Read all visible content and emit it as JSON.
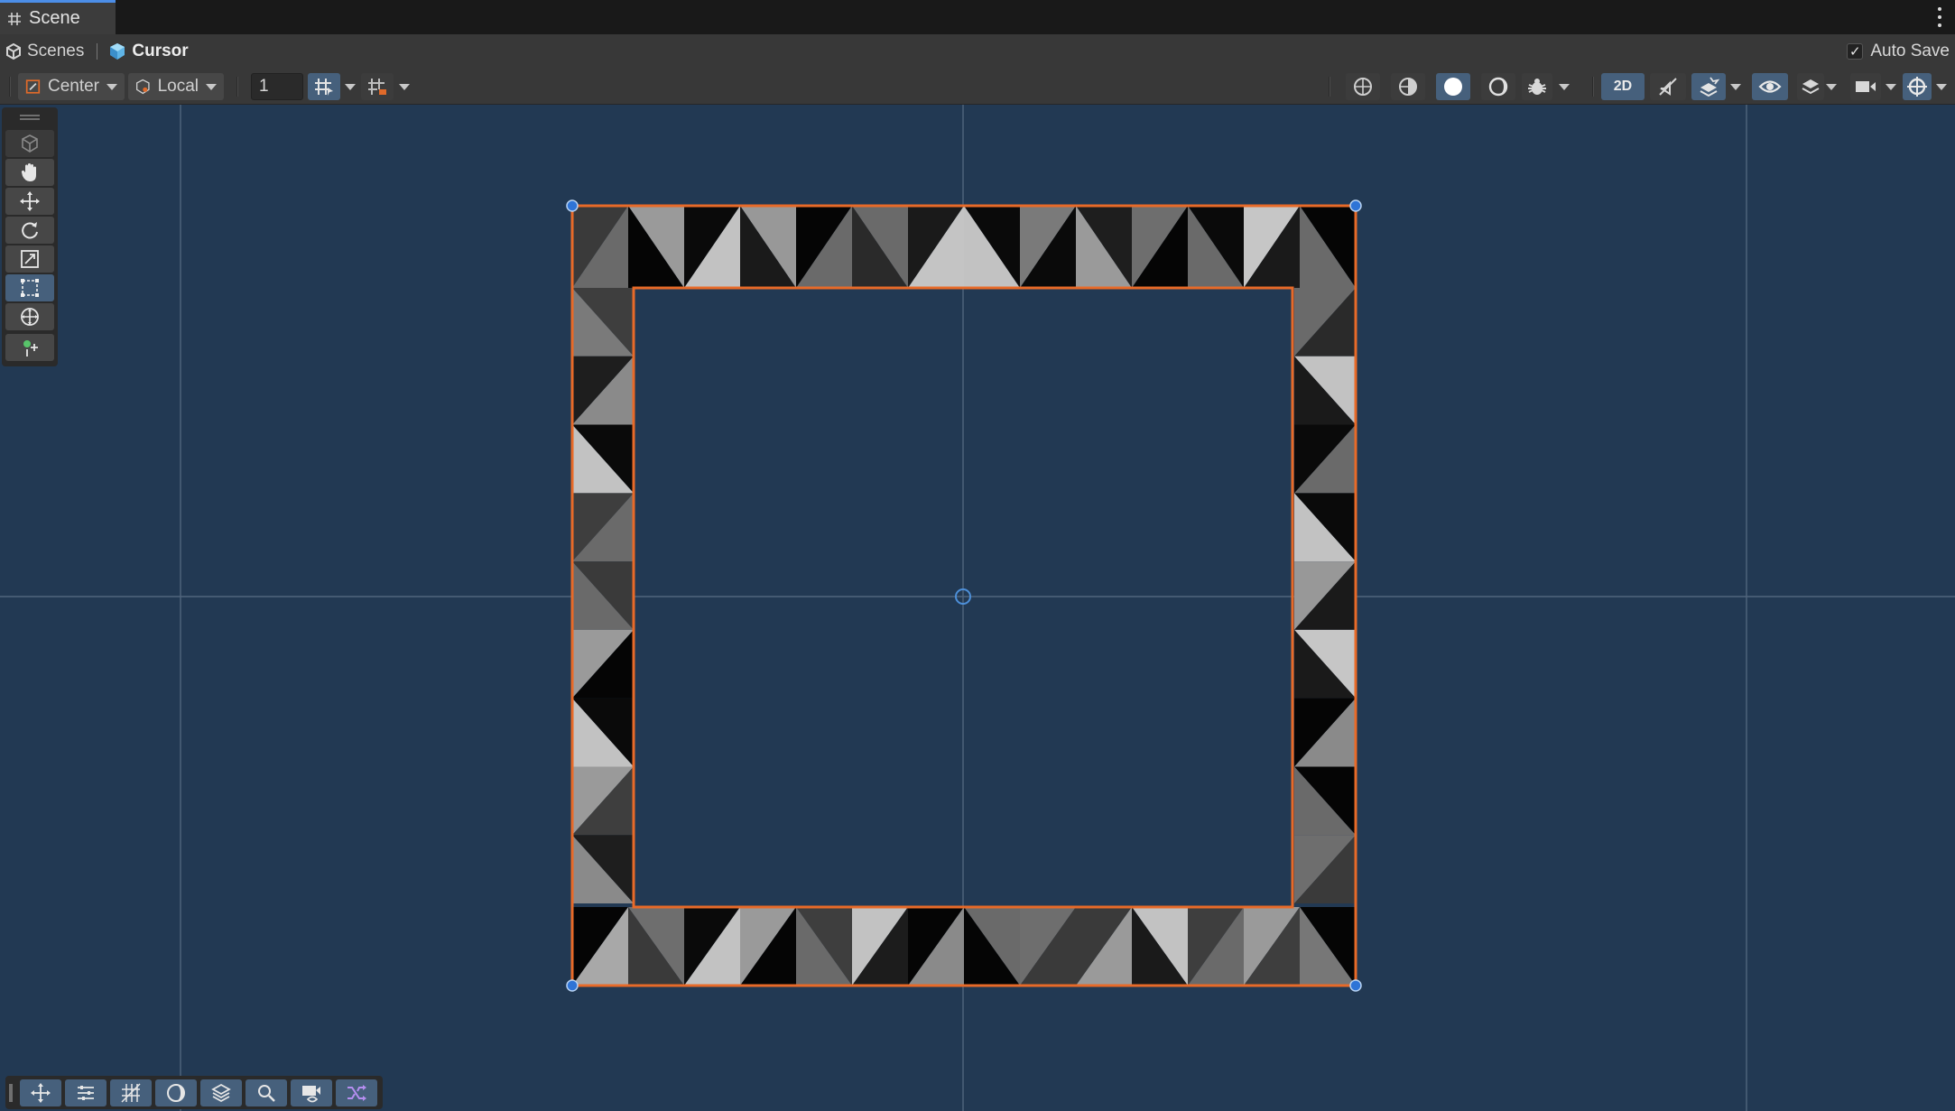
{
  "window": {
    "tab_title": "Scene",
    "tab_icon": "grid-icon",
    "menu_icon": "kebab-menu-icon"
  },
  "breadcrumb": {
    "root_label": "Scenes",
    "root_icon": "unity-scene-icon",
    "current_label": "Cursor",
    "current_icon": "prefab-cube-icon"
  },
  "autosave": {
    "label": "Auto Save",
    "checked": true,
    "check_glyph": "✓"
  },
  "toolbar": {
    "pivot_mode": "Center",
    "pivot_rotation": "Local",
    "grid_snap_value": "1",
    "view_mode_2d": "2D",
    "left_icons": [
      "pivot-center-icon",
      "pivot-local-icon",
      "grid-snap-icon",
      "increment-snap-icon"
    ],
    "right_icons": [
      "wireframe-shading-icon",
      "shaded-wireframe-icon",
      "shaded-icon",
      "unlit-icon",
      "debug-bug-icon",
      "audio-mute-icon",
      "effects-layers-icon",
      "scene-visibility-eye-icon",
      "layers-icon",
      "camera-icon",
      "gizmos-icon"
    ]
  },
  "tools": [
    {
      "name": "view-tool-cube-icon",
      "active": false
    },
    {
      "name": "hand-tool-icon",
      "active": false
    },
    {
      "name": "move-tool-icon",
      "active": false
    },
    {
      "name": "rotate-tool-icon",
      "active": false
    },
    {
      "name": "scale-tool-icon",
      "active": false
    },
    {
      "name": "rect-tool-icon",
      "active": true
    },
    {
      "name": "transform-tool-icon",
      "active": false
    },
    {
      "name": "custom-editor-tool-icon",
      "active": false
    }
  ],
  "overlays": [
    {
      "name": "move-overlay-icon",
      "active": true
    },
    {
      "name": "transform-overlay-icon",
      "active": true
    },
    {
      "name": "grid-overlay-icon",
      "active": true
    },
    {
      "name": "lighting-overlay-icon",
      "active": true
    },
    {
      "name": "layers-overlay-icon",
      "active": true
    },
    {
      "name": "search-icon",
      "active": true
    },
    {
      "name": "camera-preview-icon",
      "active": true
    },
    {
      "name": "shuffle-icon",
      "active": true
    }
  ],
  "colors": {
    "scene_bg": "#223953",
    "selection_outline": "#e86a28",
    "handle_fill": "#2f74d6",
    "active_button": "#46607c",
    "grid_line": "#51657d"
  },
  "sprite": {
    "top_row_tiles": [
      "a",
      "b",
      "c",
      "d",
      "e",
      "f",
      "g",
      "c",
      "h",
      "i",
      "j",
      "k",
      "l",
      "m"
    ],
    "bottom_row_tiles": [
      "n",
      "o",
      "c",
      "p",
      "q",
      "r",
      "s",
      "t",
      "o",
      "u",
      "v",
      "q",
      "w",
      "x"
    ],
    "left_col_tiles": [
      "y",
      "z",
      "c",
      "q",
      "a",
      "b",
      "c",
      "w",
      "z"
    ],
    "right_col_tiles": [
      "f",
      "v",
      "k",
      "c",
      "d",
      "l",
      "s",
      "m",
      "o"
    ]
  }
}
